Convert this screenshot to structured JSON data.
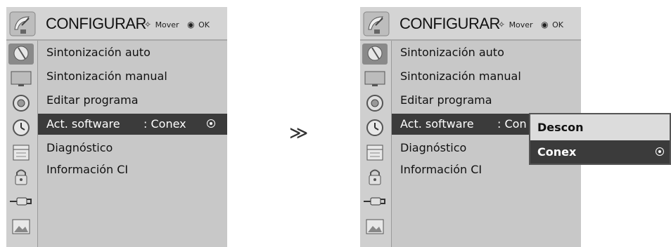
{
  "left_panel": {
    "title": "CONFIGURAR",
    "hint_move_glyph": "✧",
    "hint_move": "Mover",
    "hint_ok_glyph": "◉",
    "hint_ok": "OK",
    "items": [
      {
        "label": "Sintonización auto"
      },
      {
        "label": "Sintonización manual"
      },
      {
        "label": "Editar programa"
      },
      {
        "label": "Act. software",
        "value": ": Conex",
        "selected": true
      },
      {
        "label": "Diagnóstico"
      },
      {
        "label": "Información CI"
      }
    ]
  },
  "arrow": "≫",
  "right_panel": {
    "title": "CONFIGURAR",
    "hint_move_glyph": "✧",
    "hint_move": "Mover",
    "hint_ok_glyph": "◉",
    "hint_ok": "OK",
    "items": [
      {
        "label": "Sintonización auto"
      },
      {
        "label": "Sintonización manual"
      },
      {
        "label": "Editar programa"
      },
      {
        "label": "Act. software",
        "value": ": Con",
        "selected": true
      },
      {
        "label": "Diagnóstico"
      },
      {
        "label": "Información CI"
      }
    ],
    "popup": {
      "options": [
        "Descon",
        "Conex"
      ],
      "selected": "Conex"
    }
  },
  "sidebar_icons": [
    "satellite-dish-icon",
    "screen-icon",
    "speaker-icon",
    "clock-icon",
    "calendar-icon",
    "lock-icon",
    "connector-icon",
    "picture-icon"
  ],
  "colors": {
    "panel_bg": "#c8c8c8",
    "selected_bg": "#3b3b3b",
    "header_bg": "#d4d4d4"
  }
}
